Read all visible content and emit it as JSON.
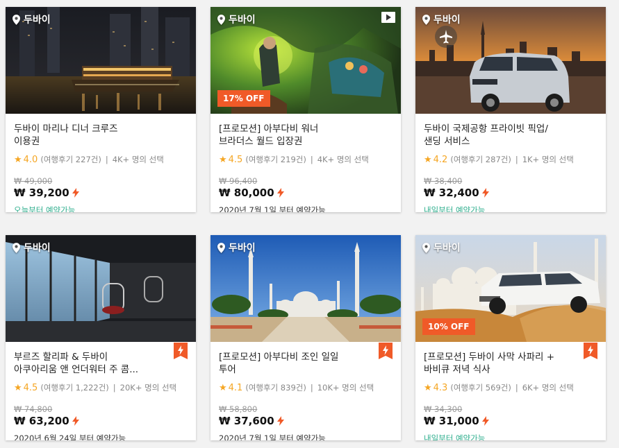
{
  "colors": {
    "discount": "#f05a28",
    "star": "#f5a623",
    "available_green": "#2eae8d",
    "flash": "#f05a28"
  },
  "cards": [
    {
      "location": "두바이",
      "title_lines": [
        "두바이 마리나 디너 크루즈",
        "이용권"
      ],
      "rating": "4.0",
      "reviews": "(여행후기 227건)",
      "selections": "4K+ 명의 선택",
      "old_price": "₩ 49,000",
      "price": "₩ 39,200",
      "availability": "오늘부터 예약가능",
      "availability_style": "green",
      "discount": "",
      "icons": []
    },
    {
      "location": "두바이",
      "title_lines": [
        "[프로모션] 아부다비 워너",
        "브라더스 월드 입장권"
      ],
      "rating": "4.5",
      "reviews": "(여행후기 219건)",
      "selections": "4K+ 명의 선택",
      "old_price": "₩ 96,400",
      "price": "₩ 80,000",
      "availability": "2020년 7월 1일 부터 예약가능",
      "availability_style": "gray",
      "discount": "17% OFF",
      "icons": [
        "video-play-icon"
      ]
    },
    {
      "location": "두바이",
      "title_lines": [
        "두바이 국제공항 프라이빗 픽업/",
        "샌딩 서비스"
      ],
      "rating": "4.2",
      "reviews": "(여행후기 287건)",
      "selections": "1K+ 명의 선택",
      "old_price": "₩ 38,400",
      "price": "₩ 32,400",
      "availability": "내일부터 예약가능",
      "availability_style": "green",
      "discount": "",
      "icons": [
        "airplane-icon"
      ]
    },
    {
      "location": "두바이",
      "title_lines": [
        "부르즈 할리파 & 두바이",
        "아쿠아리움 앤 언더워터 주 콤..."
      ],
      "rating": "4.5",
      "reviews": "(여행후기 1,222건)",
      "selections": "20K+ 명의 선택",
      "old_price": "₩ 74,800",
      "price": "₩ 63,200",
      "availability": "2020년 6월 24일 부터 예약가능",
      "availability_style": "gray",
      "discount": "",
      "icons": [
        "flash-deal-icon"
      ]
    },
    {
      "location": "두바이",
      "title_lines": [
        "[프로모션] 아부다비 조인 일일",
        "투어"
      ],
      "rating": "4.1",
      "reviews": "(여행후기 839건)",
      "selections": "10K+ 명의 선택",
      "old_price": "₩ 58,800",
      "price": "₩ 37,600",
      "availability": "2020년 7월 1일 부터 예약가능",
      "availability_style": "gray",
      "discount": "",
      "icons": [
        "flash-deal-icon"
      ]
    },
    {
      "location": "두바이",
      "title_lines": [
        "[프로모션] 두바이 사막 사파리 +",
        "바비큐 저녁 식사"
      ],
      "rating": "4.3",
      "reviews": "(여행후기 569건)",
      "selections": "6K+ 명의 선택",
      "old_price": "₩ 34,300",
      "price": "₩ 31,000",
      "availability": "내일부터 예약가능",
      "availability_style": "green",
      "discount": "10% OFF",
      "icons": [
        "flash-deal-icon"
      ]
    }
  ]
}
